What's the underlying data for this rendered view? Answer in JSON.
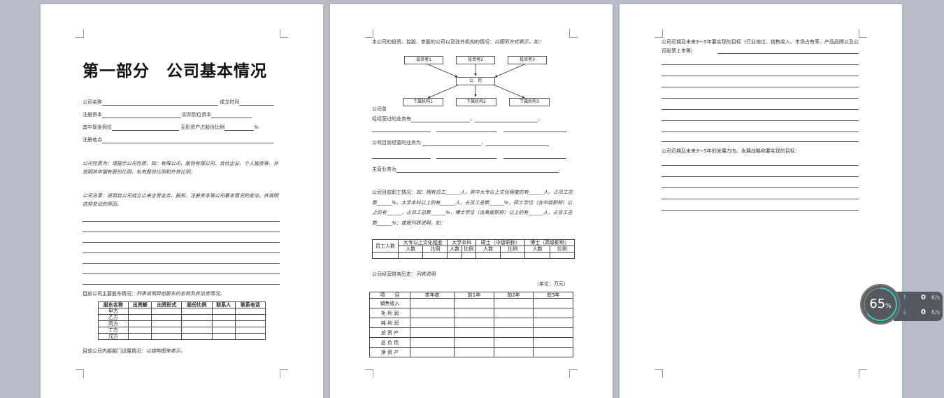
{
  "page1": {
    "title": "第一部分　公司基本情况",
    "company_name": "公司名称",
    "established": "成立时间",
    "reg_capital": "注册资本",
    "paid_capital": "实际到位资本",
    "cash_paid": "其中现金到位",
    "intangible": "无形资产占股份比例",
    "percent": "%",
    "reg_address": "注册地点",
    "nature": "公司性质为：请提示公司性质，如：有限公司、股份有限公司、合伙企业、个人独资等，并说明其中国有股份比例、私有股份比例和外资比例。",
    "history": "公司沿革：说明自公司成立以来主营业务、股权、注册资本等公司基本情况的变动，并说明这些变动的原因。",
    "shareholders_intro": "目前公司主要股东情况：",
    "shareholders_note": "列表说明目前股东的名称及其出资情况。",
    "shareholder_table": {
      "headers": [
        "股东名称",
        "出资额",
        "出资形式",
        "股份比例",
        "联系人",
        "联系电话"
      ],
      "rows": [
        "甲方",
        "乙方",
        "丙方",
        "丁方",
        "戊方"
      ]
    },
    "dept_intro": "目前公司内部部门设置情况：",
    "dept_note": "以结构图来表示。"
  },
  "page2": {
    "invest_intro": "本公司的投资、控股、参股的公司以及驻外机构的情况：",
    "invest_note": "以图形方式表示，如：",
    "chart": {
      "investors": [
        "投资者1",
        "投资者2",
        "投资者3"
      ],
      "company": "公　司",
      "subs": [
        "下属机构1",
        "下属机构2",
        "下属机构3"
      ]
    },
    "company_was": "公司曾",
    "business_once": "经经营过的业务有",
    "business_now": "公司目前经营的业务为",
    "main_business": "主营业务为",
    "staff_intro": "公司目前职工情况：",
    "staff_body": "如：拥有员工______人，其中大专以上文化程度的有______人，占员工总数______%，大学本科以上的有______人，占员工总数______%，硕士学位（含中级职称）以上的有______，占员工总数______%，博士学位（含高级职称）以上的有______人，占员工总数______%；或按列表说明，如：",
    "staff_table": {
      "col0": "员工人数",
      "groups": [
        "大专以上文化程度",
        "大学本科",
        "硕士（中级职称）",
        "博士（高级职称）"
      ],
      "sub": [
        "人数",
        "比例"
      ]
    },
    "finance_intro": "公司经营财务历史：",
    "finance_note": "列表说明",
    "unit": "（单位：万元）",
    "finance_table": {
      "headers": [
        "项　　目",
        "本年度",
        "前1年",
        "前2年",
        "前3年"
      ],
      "rows": [
        "销售收入",
        "毛 利 润",
        "纯 利 润",
        "总 资 产",
        "总 负 债",
        "净 资 产"
      ]
    }
  },
  "page3": {
    "goals_short": "公司近期及未来3～5年要实现的目标（行业地位、销售收入、市场占有率、产品品牌以及公司股票上市等）",
    "goals_long": "公司近期及未来3～5年的发展方向、发展战略和要实现的目标："
  },
  "widget": {
    "percent": "65",
    "percent_sign": "%",
    "up_arrow": "↑",
    "down_arrow": "↓",
    "up_value": "0",
    "down_value": "0",
    "unit": "K/s",
    "ring_value": 0.65,
    "ring_color": "#2ecfb0"
  }
}
